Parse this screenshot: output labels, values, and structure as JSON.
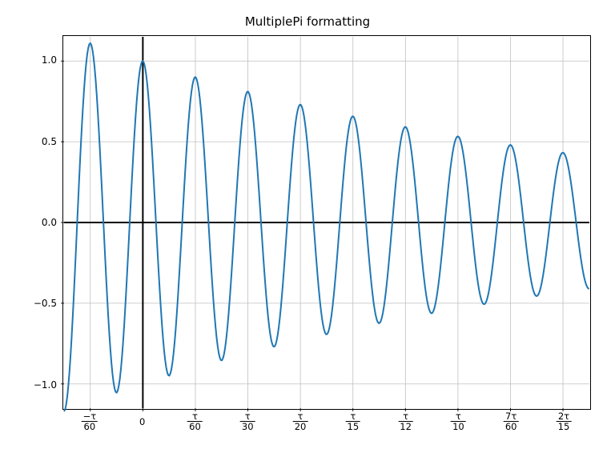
{
  "chart_data": {
    "type": "line",
    "title": "MultiplePi formatting",
    "line_color": "#1f77b4",
    "xlim_tau": [
      -0.025,
      0.1417
    ],
    "ylim": [
      -1.15,
      1.15
    ],
    "y_ticks": [
      -1.0,
      -0.5,
      0.0,
      0.5,
      1.0
    ],
    "y_tick_labels": [
      "−1.0",
      "−0.5",
      "0.0",
      "0.5",
      "1.0"
    ],
    "x_ticks_tau": [
      -0.01667,
      0,
      0.01667,
      0.03333,
      0.05,
      0.06667,
      0.08333,
      0.1,
      0.11667,
      0.13333
    ],
    "x_tick_labels": [
      {
        "num": "−τ",
        "den": "60"
      },
      {
        "plain": "0"
      },
      {
        "num": "τ",
        "den": "60"
      },
      {
        "num": "τ",
        "den": "30"
      },
      {
        "num": "τ",
        "den": "20"
      },
      {
        "num": "τ",
        "den": "15"
      },
      {
        "num": "τ",
        "den": "12"
      },
      {
        "num": "τ",
        "den": "10"
      },
      {
        "num": "7τ",
        "den": "60"
      },
      {
        "num": "2τ",
        "den": "15"
      }
    ],
    "function": "exp(-x) * cos(60*x)",
    "x_range_actual": [
      -0.1571,
      0.8901
    ],
    "samples": 500,
    "peak_amplitudes_approx": [
      1.11,
      1.0,
      0.9,
      0.81,
      0.73,
      0.66,
      0.59,
      0.53,
      0.48,
      0.43
    ],
    "xlabel": "",
    "ylabel": ""
  }
}
